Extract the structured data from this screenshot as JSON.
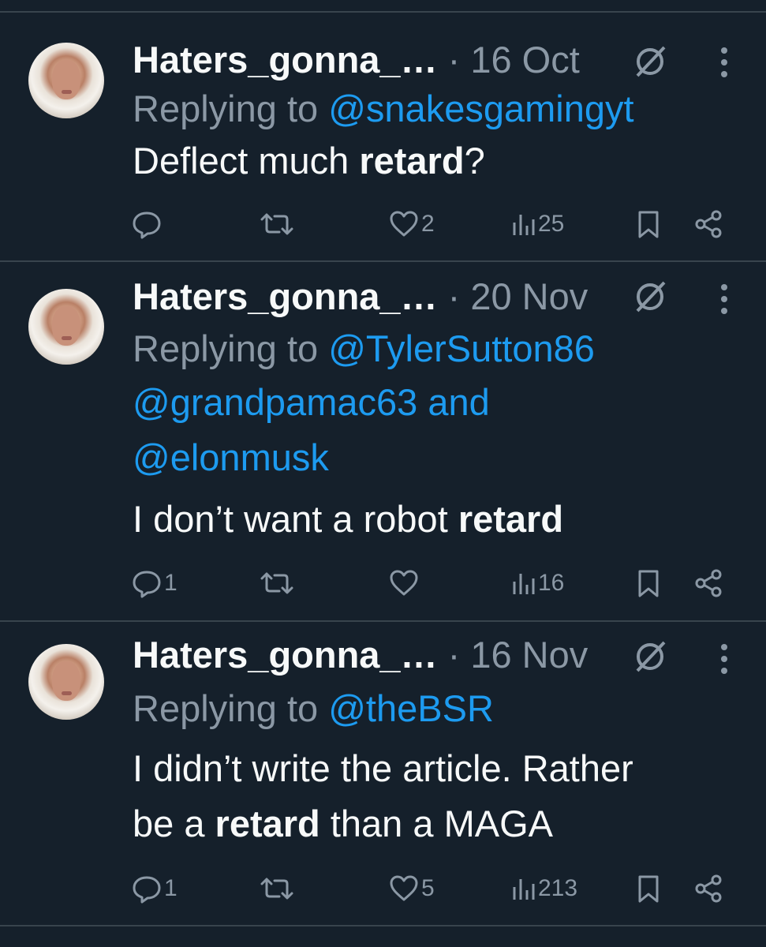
{
  "tweets": [
    {
      "author": "Haters_gonna_…",
      "separator": "·",
      "date": "16 Oct",
      "replying_prefix": "Replying to ",
      "reply_lines": [
        [
          "@snakesgamingyt"
        ]
      ],
      "text_lines": [
        {
          "before": "Deflect much ",
          "bold": "retard",
          "after": "?"
        }
      ],
      "replies": "",
      "reposts": "",
      "likes": "2",
      "views": "25"
    },
    {
      "author": "Haters_gonna_…",
      "separator": "·",
      "date": "20 Nov",
      "replying_prefix": "Replying to ",
      "reply_lines": [
        [
          "@TylerSutton86"
        ],
        [
          "@grandpamac63 and"
        ],
        [
          "@elonmusk"
        ]
      ],
      "text_lines": [
        {
          "before": "I don’t want a robot ",
          "bold": "retard",
          "after": ""
        }
      ],
      "replies": "1",
      "reposts": "",
      "likes": "",
      "views": "16"
    },
    {
      "author": "Haters_gonna_…",
      "separator": "·",
      "date": "16 Nov",
      "replying_prefix": "Replying to ",
      "reply_lines": [
        [
          "@theBSR"
        ]
      ],
      "text_lines": [
        {
          "before": "I didn’t write the article. Rather",
          "bold": "",
          "after": ""
        },
        {
          "before": "be a ",
          "bold": "retard",
          "after": " than a MAGA"
        }
      ],
      "replies": "1",
      "reposts": "",
      "likes": "5",
      "views": "213"
    }
  ],
  "colors": {
    "background": "#15202b",
    "divider": "#38444d",
    "text": "#f7f9f9",
    "muted": "#8b98a5",
    "link": "#1d9bf0"
  },
  "icons": [
    "grok-icon",
    "more-icon",
    "reply-icon",
    "repost-icon",
    "like-icon",
    "views-icon",
    "bookmark-icon",
    "share-icon"
  ]
}
